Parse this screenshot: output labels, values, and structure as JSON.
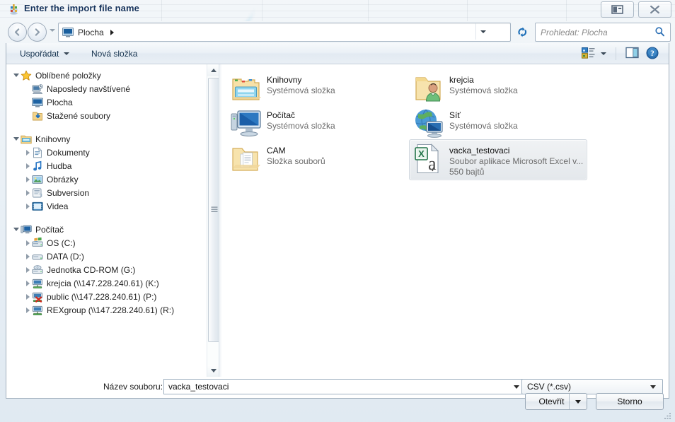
{
  "window": {
    "title": "Enter the import file name",
    "app_icon": "app-icon",
    "controls": [
      {
        "name": "preview-pane-button",
        "icon": "pane-icon"
      },
      {
        "name": "close-button",
        "icon": "close-icon"
      }
    ]
  },
  "nav": {
    "back_label": "Zpět",
    "forward_label": "Vpřed",
    "history_label": "Naposledy navštívené umístění",
    "breadcrumb": {
      "icon": "desktop-icon",
      "path": "Plocha"
    },
    "refresh_label": "Obnovit",
    "search": {
      "placeholder": "Prohledat: Plocha",
      "icon": "search-icon"
    }
  },
  "toolbar": {
    "organize_label": "Uspořádat",
    "new_folder_label": "Nová složka",
    "view_icon": "view-mode-icon",
    "pane_icon": "preview-pane-icon",
    "help_icon": "help-icon"
  },
  "sidebar": {
    "groups": [
      {
        "name": "Oblíbené položky",
        "icon": "star-icon",
        "expanded": true,
        "items": [
          {
            "label": "Naposledy navštívené",
            "icon": "recent-places-icon",
            "expandable": false
          },
          {
            "label": "Plocha",
            "icon": "desktop-icon",
            "expandable": false
          },
          {
            "label": "Stažené soubory",
            "icon": "downloads-icon",
            "expandable": false
          }
        ]
      },
      {
        "name": "Knihovny",
        "icon": "libraries-icon",
        "expanded": true,
        "items": [
          {
            "label": "Dokumenty",
            "icon": "documents-icon",
            "expandable": true
          },
          {
            "label": "Hudba",
            "icon": "music-icon",
            "expandable": true
          },
          {
            "label": "Obrázky",
            "icon": "pictures-icon",
            "expandable": true
          },
          {
            "label": "Subversion",
            "icon": "subversion-icon",
            "expandable": true
          },
          {
            "label": "Videa",
            "icon": "videos-icon",
            "expandable": true
          }
        ]
      },
      {
        "name": "Počítač",
        "icon": "computer-icon",
        "expanded": true,
        "items": [
          {
            "label": "OS (C:)",
            "icon": "windows-drive-icon",
            "expandable": true
          },
          {
            "label": "DATA (D:)",
            "icon": "drive-icon",
            "expandable": true
          },
          {
            "label": "Jednotka CD-ROM (G:)",
            "icon": "cdrom-icon",
            "expandable": true
          },
          {
            "label": "krejcia (\\\\147.228.240.61) (K:)",
            "icon": "network-drive-icon",
            "expandable": true
          },
          {
            "label": "public (\\\\147.228.240.61) (P:)",
            "icon": "network-drive-disconnected-icon",
            "expandable": true
          },
          {
            "label": "REXgroup (\\\\147.228.240.61) (R:)",
            "icon": "network-drive-icon",
            "expandable": true
          }
        ]
      }
    ],
    "scrollbar": {
      "up_icon": "scroll-up-icon",
      "down_icon": "scroll-down-icon"
    }
  },
  "files": [
    {
      "name": "Knihovny",
      "type": "Systémová složka",
      "size": "",
      "icon": "libraries-folder-icon",
      "selected": false,
      "col": 0,
      "row": 0
    },
    {
      "name": "krejcia",
      "type": "Systémová složka",
      "size": "",
      "icon": "user-folder-icon",
      "selected": false,
      "col": 1,
      "row": 0
    },
    {
      "name": "Počítač",
      "type": "Systémová složka",
      "size": "",
      "icon": "computer-big-icon",
      "selected": false,
      "col": 0,
      "row": 1
    },
    {
      "name": "Síť",
      "type": "Systémová složka",
      "size": "",
      "icon": "network-big-icon",
      "selected": false,
      "col": 1,
      "row": 1
    },
    {
      "name": "CAM",
      "type": "Složka souborů",
      "size": "",
      "icon": "folder-icon",
      "selected": false,
      "col": 0,
      "row": 2
    },
    {
      "name": "vacka_testovaci",
      "type": "Soubor aplikace Microsoft Excel v...",
      "size": "550 bajtů",
      "icon": "excel-csv-icon",
      "selected": true,
      "col": 1,
      "row": 2
    }
  ],
  "footer": {
    "filename_label": "Název souboru:",
    "filename_value": "vacka_testovaci",
    "filetype_value": "CSV (*.csv)",
    "open_label": "Otevřít",
    "cancel_label": "Storno"
  },
  "colors": {
    "accent": "#1f6fbd",
    "title_text": "#16335c",
    "excel_green": "#1f7246",
    "folder_yellow": "#f5d98a"
  }
}
